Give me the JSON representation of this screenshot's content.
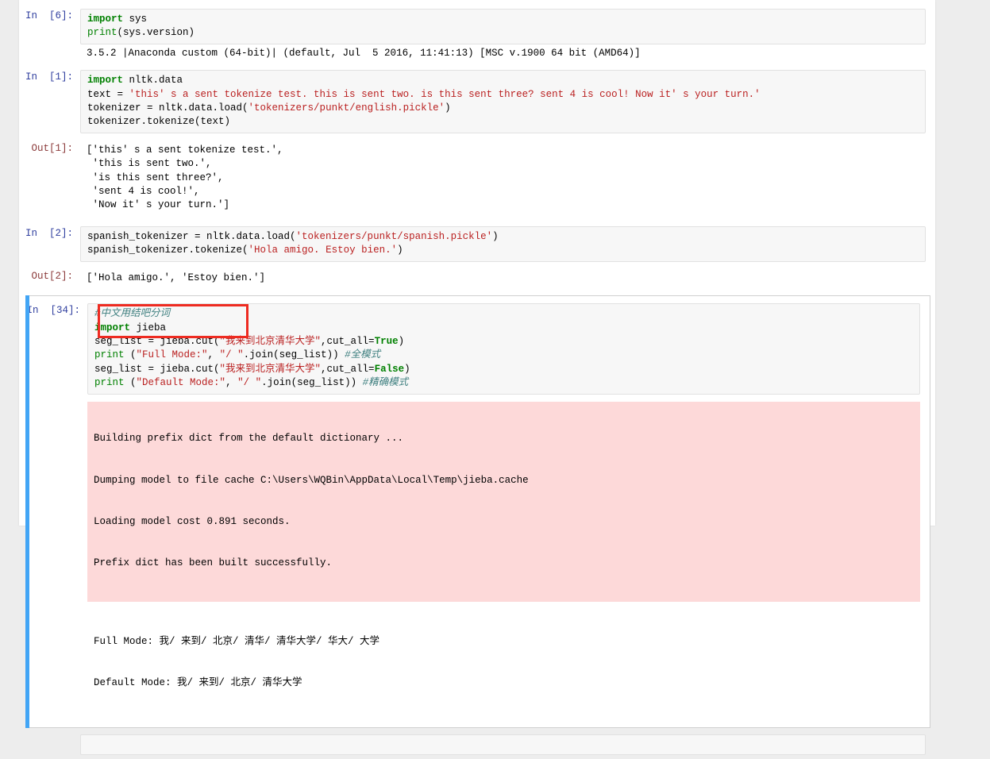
{
  "app": {
    "kind": "jupyter-notebook",
    "page_background": "#ededed",
    "page_surface": "#ffffff",
    "selected_cell_bar_color": "#42a5f5",
    "annotation_box_color": "#ee2b21",
    "stderr_background": "#fdd9d9",
    "input_background": "#f7f7f7"
  },
  "cells": [
    {
      "prompt": "In  [6]:",
      "prompt_kind": "in",
      "code_lines": [
        "import sys",
        "print(sys.version)"
      ],
      "stdout": "3.5.2 |Anaconda custom (64-bit)| (default, Jul  5 2016, 11:41:13) [MSC v.1900 64 bit (AMD64)]"
    },
    {
      "prompt": "In  [1]:",
      "prompt_kind": "in",
      "code_lines": [
        "import nltk.data",
        "text = 'this' s a sent tokenize test. this is sent two. is this sent three? sent 4 is cool! Now it' s your turn.'",
        "tokenizer = nltk.data.load('tokenizers/punkt/english.pickle')",
        "tokenizer.tokenize(text)"
      ],
      "out_prompt": "Out[1]:",
      "out_lines": [
        "['this' s a sent tokenize test.',",
        " 'this is sent two.',",
        " 'is this sent three?',",
        " 'sent 4 is cool!',",
        " 'Now it' s your turn.']"
      ]
    },
    {
      "prompt": "In  [2]:",
      "prompt_kind": "in",
      "code_lines": [
        "spanish_tokenizer = nltk.data.load('tokenizers/punkt/spanish.pickle')",
        "spanish_tokenizer.tokenize('Hola amigo. Estoy bien.')"
      ],
      "out_prompt": "Out[2]:",
      "out_lines": [
        "['Hola amigo.', 'Estoy bien.']"
      ]
    },
    {
      "prompt": "In  [34]:",
      "prompt_kind": "in",
      "selected": true,
      "code_lines": [
        "#中文用结吧分词",
        "import jieba",
        "seg_list = jieba.cut(\"我来到北京清华大学\",cut_all=True)",
        "print (\"Full Mode:\", \"/ \".join(seg_list)) #全模式",
        "",
        "seg_list = jieba.cut(\"我来到北京清华大学\",cut_all=False)",
        "print (\"Default Mode:\", \"/ \".join(seg_list)) #精确模式"
      ],
      "stderr_lines": [
        "Building prefix dict from the default dictionary ...",
        "Dumping model to file cache C:\\Users\\WQBin\\AppData\\Local\\Temp\\jieba.cache",
        "Loading model cost 0.891 seconds.",
        "Prefix dict has been built successfully."
      ],
      "stdout_lines": [
        "Full Mode: 我/ 来到/ 北京/ 清华/ 清华大学/ 华大/ 大学",
        "Default Mode: 我/ 来到/ 北京/ 清华大学"
      ]
    },
    {
      "prompt": "",
      "prompt_kind": "in",
      "partial": true,
      "code_lines": [
        ""
      ]
    }
  ],
  "annotation": {
    "label": "red-highlight-rectangle",
    "targets": [
      "#中文用结吧分词",
      "import jieba"
    ]
  }
}
